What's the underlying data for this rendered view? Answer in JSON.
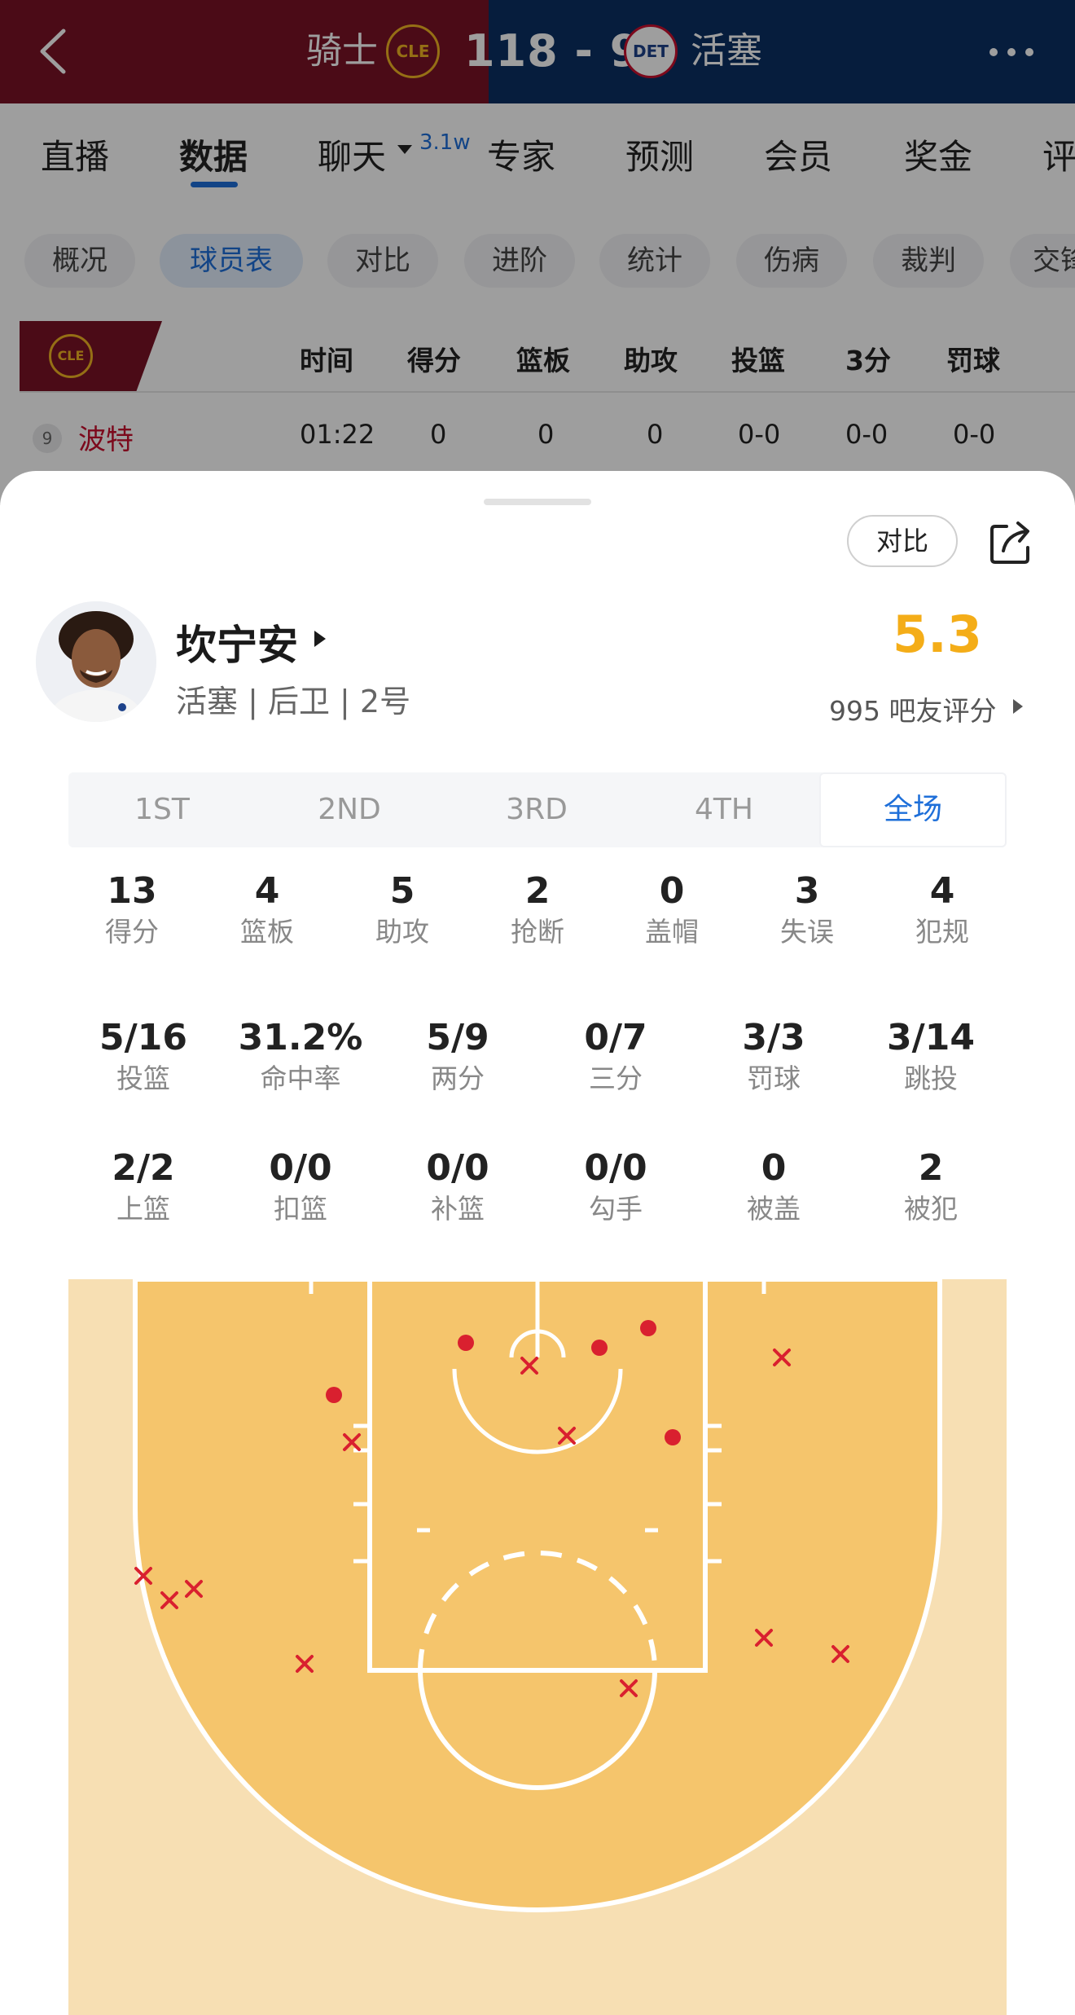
{
  "header": {
    "home_team": "骑士",
    "home_abbr": "CLE",
    "score": "118 - 92",
    "away_abbr": "DET",
    "away_team": "活塞",
    "colors": {
      "home": "#7a1326",
      "away": "#0a2f63"
    }
  },
  "tabs": {
    "items": [
      "直播",
      "数据",
      "聊天",
      "专家",
      "预测",
      "会员",
      "奖金",
      "评"
    ],
    "active": "数据",
    "chat_badge": "3.1w"
  },
  "subtabs": {
    "items": [
      "概况",
      "球员表",
      "对比",
      "进阶",
      "统计",
      "伤病",
      "裁判",
      "交锋"
    ],
    "active": "球员表"
  },
  "player_table": {
    "team_abbr": "CLE",
    "columns": [
      "时间",
      "得分",
      "篮板",
      "助攻",
      "投篮",
      "3分",
      "罚球"
    ],
    "rows": [
      {
        "number": "9",
        "name": "波特",
        "cells": [
          "01:22",
          "0",
          "0",
          "0",
          "0-0",
          "0-0",
          "0-0"
        ]
      }
    ]
  },
  "sheet": {
    "compare_label": "对比",
    "player": {
      "name": "坎宁安",
      "info": "活塞 | 后卫 | 2号"
    },
    "rating": {
      "value": "5.3",
      "label": "995 吧友评分"
    },
    "periods": [
      "1ST",
      "2ND",
      "3RD",
      "4TH",
      "全场"
    ],
    "active_period": "全场",
    "stats_row1": [
      {
        "value": "13",
        "label": "得分"
      },
      {
        "value": "4",
        "label": "篮板"
      },
      {
        "value": "5",
        "label": "助攻"
      },
      {
        "value": "2",
        "label": "抢断"
      },
      {
        "value": "0",
        "label": "盖帽"
      },
      {
        "value": "3",
        "label": "失误"
      },
      {
        "value": "4",
        "label": "犯规"
      }
    ],
    "stats_row2": [
      {
        "value": "5/16",
        "label": "投篮"
      },
      {
        "value": "31.2%",
        "label": "命中率"
      },
      {
        "value": "5/9",
        "label": "两分"
      },
      {
        "value": "0/7",
        "label": "三分"
      },
      {
        "value": "3/3",
        "label": "罚球"
      },
      {
        "value": "3/14",
        "label": "跳投"
      }
    ],
    "stats_row3": [
      {
        "value": "2/2",
        "label": "上篮"
      },
      {
        "value": "0/0",
        "label": "扣篮"
      },
      {
        "value": "0/0",
        "label": "补篮"
      },
      {
        "value": "0/0",
        "label": "勾手"
      },
      {
        "value": "0",
        "label": "被盖"
      },
      {
        "value": "2",
        "label": "被犯"
      }
    ],
    "shot_chart": {
      "colors": {
        "make": "#d9202f",
        "miss": "#d9202f",
        "paint": "#f5c56c",
        "outside": "#f7dfb3"
      },
      "makes_count": 5,
      "misses_count": 11
    }
  }
}
